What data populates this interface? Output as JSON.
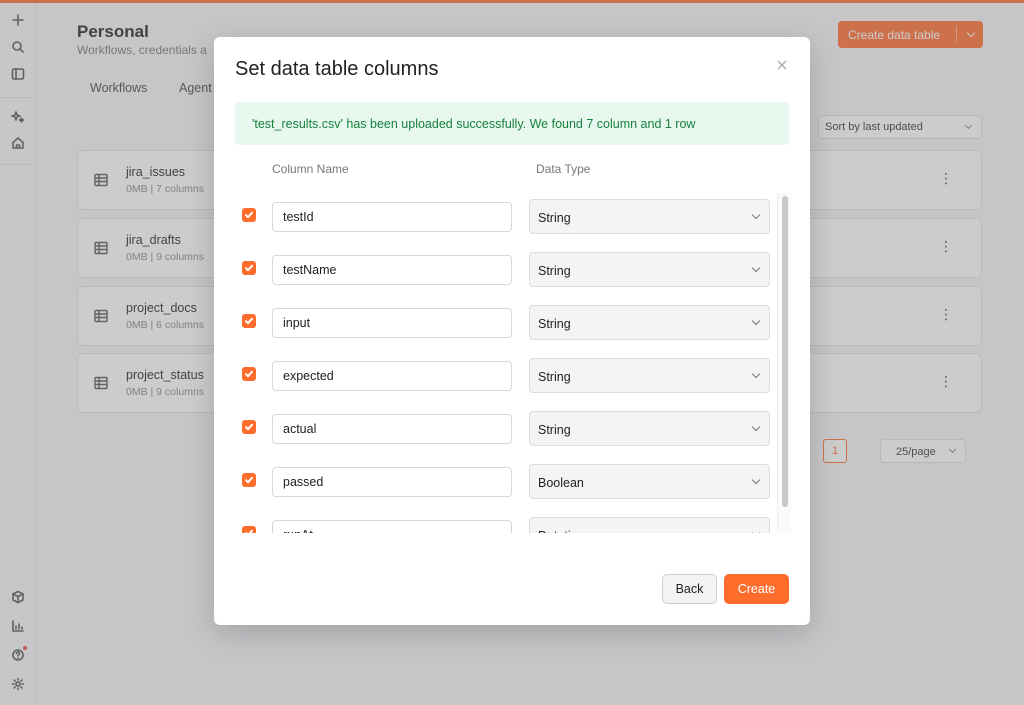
{
  "sidebar": {
    "icons": [
      "plus-icon",
      "search-icon",
      "panel-icon",
      "sparkle-icon",
      "home-icon"
    ],
    "bottom_icons": [
      "package-icon",
      "chart-icon",
      "help-icon",
      "gear-icon"
    ]
  },
  "page": {
    "title": "Personal",
    "subtitle": "Workflows, credentials a",
    "create_button": "Create data table",
    "tabs": [
      "Workflows",
      "Agent"
    ],
    "sort_label": "Sort by last updated",
    "tables": [
      {
        "name": "jira_issues",
        "meta": "0MB | 7 columns"
      },
      {
        "name": "jira_drafts",
        "meta": "0MB | 9 columns"
      },
      {
        "name": "project_docs",
        "meta": "0MB | 6 columns"
      },
      {
        "name": "project_status",
        "meta": "0MB | 9 columns"
      }
    ],
    "pagination": {
      "current_page": "1",
      "page_size": "25/page"
    }
  },
  "modal": {
    "title": "Set data table columns",
    "alert": "'test_results.csv' has been uploaded successfully. We found 7 column and 1 row",
    "headers": {
      "name": "Column Name",
      "type": "Data Type"
    },
    "columns": [
      {
        "name": "testId",
        "type": "String",
        "checked": true
      },
      {
        "name": "testName",
        "type": "String",
        "checked": true
      },
      {
        "name": "input",
        "type": "String",
        "checked": true
      },
      {
        "name": "expected",
        "type": "String",
        "checked": true
      },
      {
        "name": "actual",
        "type": "String",
        "checked": true
      },
      {
        "name": "passed",
        "type": "Boolean",
        "checked": true
      },
      {
        "name": "runAt",
        "type": "Datetime",
        "checked": true
      }
    ],
    "back_label": "Back",
    "create_label": "Create"
  },
  "colors": {
    "accent": "#ff6d2d",
    "success_bg": "#e8f8ee",
    "success_text": "#17803f"
  }
}
